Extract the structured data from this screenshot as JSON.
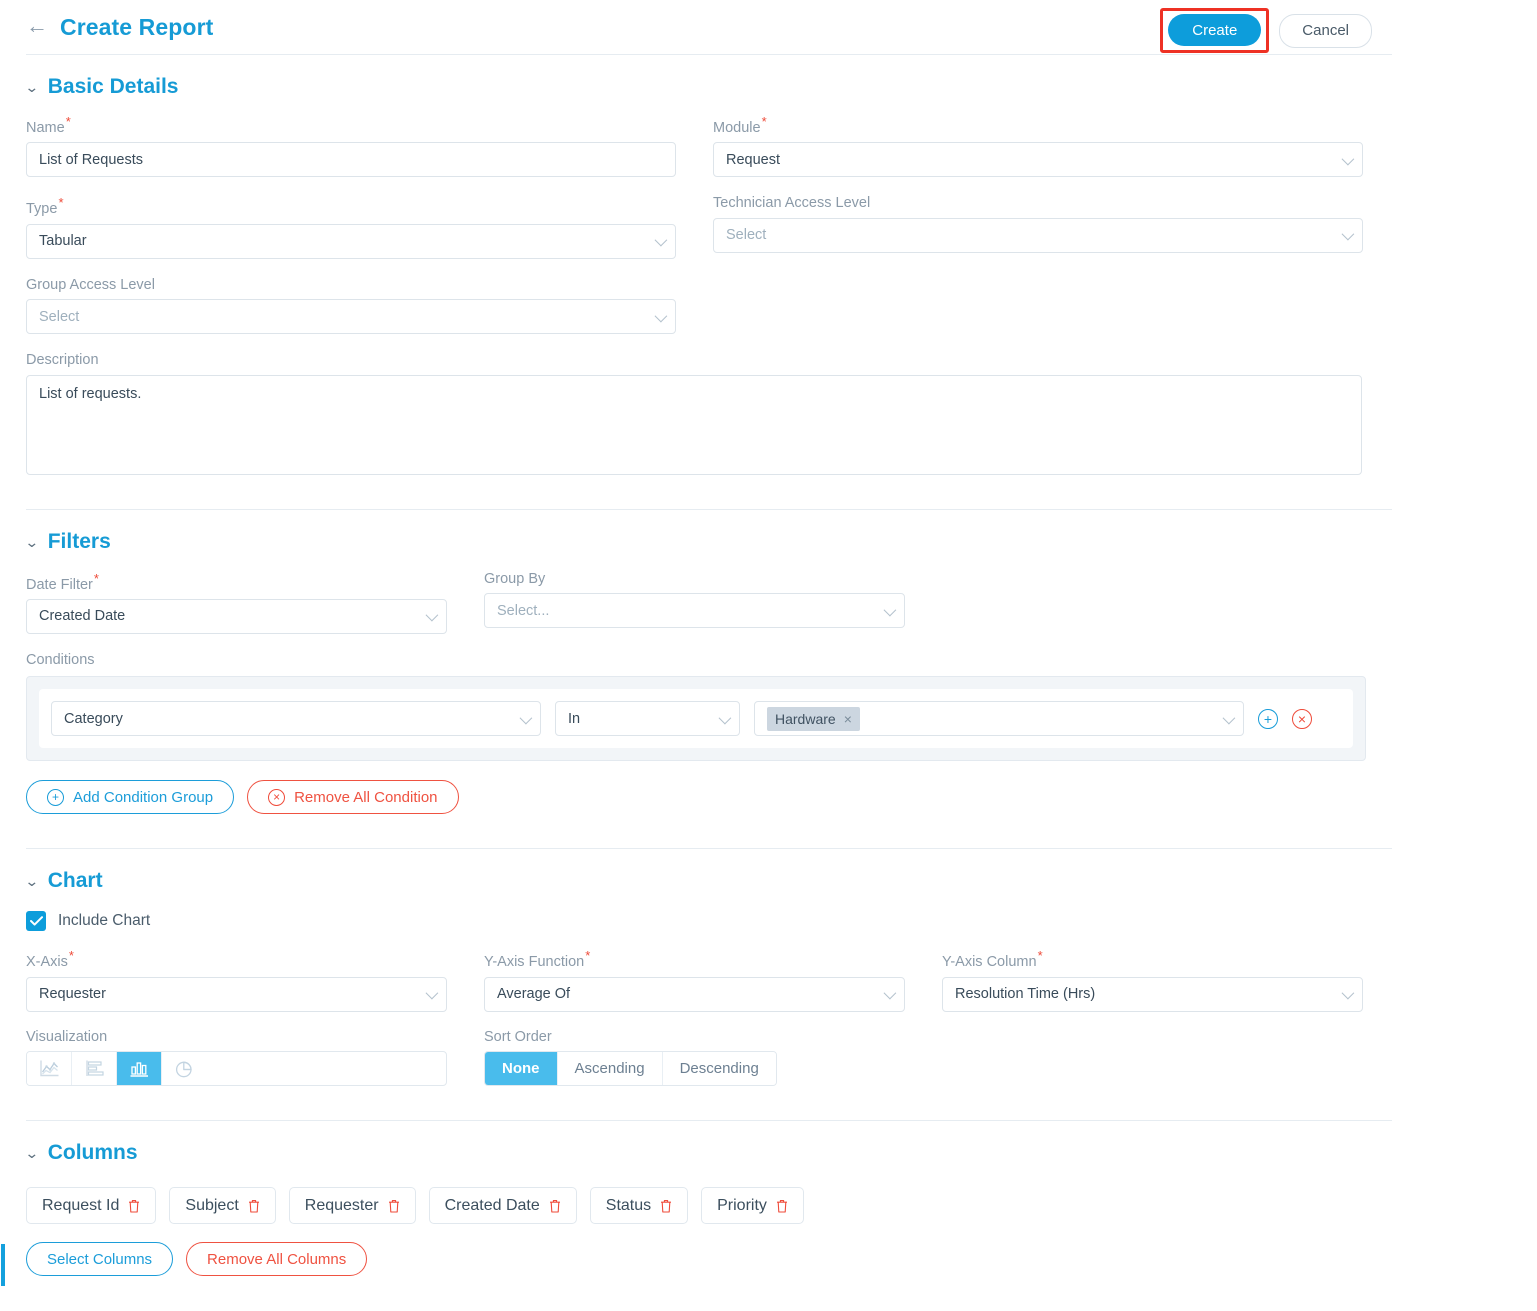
{
  "header": {
    "back_icon": "arrow-left-icon",
    "title": "Create Report",
    "create_label": "Create",
    "cancel_label": "Cancel",
    "highlight_color": "#ee3124",
    "accent_color": "#0d9ddb"
  },
  "basic_details": {
    "title": "Basic Details",
    "name": {
      "label": "Name",
      "required": "*",
      "value": "List of Requests"
    },
    "module": {
      "label": "Module",
      "required": "*",
      "value": "Request"
    },
    "type": {
      "label": "Type",
      "required": "*",
      "value": "Tabular"
    },
    "technician_access_level": {
      "label": "Technician Access Level",
      "required": "",
      "value": "Select"
    },
    "group_access_level": {
      "label": "Group Access Level",
      "required": "",
      "value": "Select"
    },
    "description": {
      "label": "Description",
      "value": "List of requests."
    }
  },
  "filters": {
    "title": "Filters",
    "date_filter": {
      "label": "Date Filter",
      "required": "*",
      "value": "Created Date"
    },
    "group_by": {
      "label": "Group By",
      "required": "",
      "value": "Select..."
    },
    "conditions_label": "Conditions",
    "condition": {
      "field": "Category",
      "operator": "In",
      "value_chip": "Hardware",
      "chip_remove": "×",
      "add_icon": "plus-circle-icon",
      "remove_icon": "remove-circle-icon"
    },
    "add_condition_group_label": "Add Condition Group",
    "remove_all_condition_label": "Remove All Condition"
  },
  "chart": {
    "title": "Chart",
    "include_chart_label": "Include Chart",
    "include_chart_checked": true,
    "x_axis": {
      "label": "X-Axis",
      "required": "*",
      "value": "Requester"
    },
    "y_axis_function": {
      "label": "Y-Axis Function",
      "required": "*",
      "value": "Average Of"
    },
    "y_axis_column": {
      "label": "Y-Axis Column",
      "required": "*",
      "value": "Resolution Time (Hrs)"
    },
    "visualization": {
      "label": "Visualization",
      "options": [
        "line-chart-icon",
        "horizontal-bar-chart-icon",
        "vertical-bar-chart-icon",
        "pie-chart-icon"
      ],
      "selected_index": 2,
      "selected_color": "#49bcec"
    },
    "sort_order": {
      "label": "Sort Order",
      "options": [
        "None",
        "Ascending",
        "Descending"
      ],
      "selected_index": 0
    }
  },
  "columns": {
    "title": "Columns",
    "items": [
      "Request Id",
      "Subject",
      "Requester",
      "Created Date",
      "Status",
      "Priority"
    ],
    "select_columns_label": "Select Columns",
    "remove_all_columns_label": "Remove All Columns"
  }
}
